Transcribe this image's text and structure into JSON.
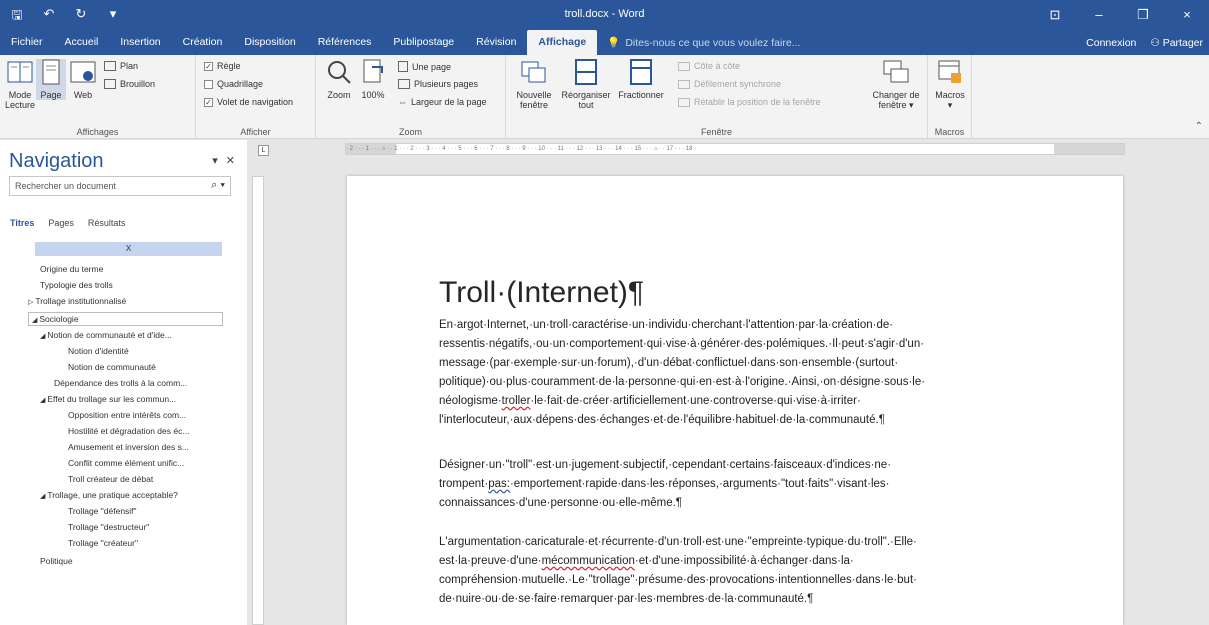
{
  "window": {
    "title": "troll.docx - Word",
    "qat": [
      "save-icon",
      "undo-icon",
      "redo-icon",
      "customize-icon"
    ],
    "controls": {
      "restore": "⊡",
      "minimize": "–",
      "maximize": "❐",
      "close": "×"
    }
  },
  "tabs": [
    "Fichier",
    "Accueil",
    "Insertion",
    "Création",
    "Disposition",
    "Références",
    "Publipostage",
    "Révision",
    "Affichage"
  ],
  "tell_me": "Dites-nous ce que vous voulez faire...",
  "tabs_right": {
    "signin": "Connexion",
    "share": "Partager"
  },
  "ribbon": {
    "affichages": {
      "label": "Affichages",
      "mode_lecture": [
        "Mode",
        "Lecture"
      ],
      "page": "Page",
      "web": "Web",
      "plan": "Plan",
      "brouillon": "Brouillon"
    },
    "afficher": {
      "label": "Afficher",
      "regle": "Règle",
      "quadrillage": "Quadrillage",
      "volet": "Volet de navigation"
    },
    "zoom": {
      "label": "Zoom",
      "zoom": "Zoom",
      "pct": "100%",
      "une_page": "Une page",
      "plusieurs": "Plusieurs pages",
      "largeur": "Largeur de la page"
    },
    "fenetre": {
      "label": "Fenêtre",
      "nouvelle": [
        "Nouvelle",
        "fenêtre"
      ],
      "reorganiser": [
        "Réorganiser",
        "tout"
      ],
      "fractionner": "Fractionner",
      "cote": "Côte à côte",
      "defilement": "Défilement synchrone",
      "retablir": "Rétablir la position de la fenêtre",
      "changer": [
        "Changer de",
        "fenêtre ▾"
      ]
    },
    "macros": {
      "label": "Macros",
      "macros": "Macros"
    }
  },
  "nav": {
    "title": "Navigation",
    "search_placeholder": "Rechercher un document",
    "tabs": [
      "Titres",
      "Pages",
      "Résultats"
    ],
    "header_item": "X",
    "items": [
      "Origine du terme",
      "Typologie des trolls",
      "Trollage institutionnalisé",
      "Sociologie",
      "Notion de communauté et d'ide...",
      "Notion d'identité",
      "Notion de communauté",
      "Dépendance des trolls à la comm...",
      "Effet du trollage sur les commun...",
      "Opposition entre intérêts com...",
      "Hostilité et dégradation des éc...",
      "Amusement et inversion des s...",
      "Conflit comme élément unific...",
      "Troll créateur de débat",
      "Trollage, une pratique acceptable?",
      "Trollage \"défensif\"",
      "Trollage \"destructeur\"",
      "Trollage \"créateur\"",
      "Politique"
    ]
  },
  "ruler_text": "· 2 · · · 1 · · · ⌂ · · 1 · · · 2 · · · 3 · · · 4 · · · 5 · · · 6 · · · 7 · · · 8 · · · 9 · · · 10 · · · 11 · · · 12 · · · 13 · · · 14 · · · 15 · · · ⌂ · · 17 · · · 18 ·",
  "doc": {
    "title": "Troll·(Internet)¶",
    "p1_a": "En·argot·Internet,·un·troll·caractérise·un·individu·cherchant·l'attention·par·la·création·de· ressentis·négatifs,·ou·un·comportement·qui·vise·à·générer·des·polémiques.·Il·peut·s'agir·d'un· message·(par·exemple·sur·un·forum),·d'un·débat·conflictuel·dans·son·ensemble·(surtout· politique)·ou·plus·couramment·de·la·personne·qui·en·est·à·l'origine.·Ainsi,·on·désigne·sous·le· néologisme·",
    "p1_troller": "troller",
    "p1_b": "·le·fait·de·créer·artificiellement·une·controverse·qui·vise·à·irriter· l'interlocuteur,·aux·dépens·des·échanges·et·de·l'équilibre·habituel·de·la·communauté.¶",
    "p2_a": "Désigner·un·\"troll\"·est·un·jugement·subjectif,·cependant·certains·faisceaux·d'indices·ne· trompent·",
    "p2_pas": "pas:",
    "p2_b": "·emportement·rapide·dans·les·réponses,·arguments·\"tout·faits\"·visant·les· connaissances·d'une·personne·ou·elle-même.¶",
    "p3_a": "L'argumentation·caricaturale·et·récurrente·d'un·troll·est·une·\"empreinte·typique·du·troll\".·Elle· est·la·preuve·d'une·",
    "p3_meco": "mécommunication",
    "p3_b": "·et·d'une·impossibilité·à·échanger·dans·la· compréhension·mutuelle.·Le·\"trollage\"·présume·des·provocations·intentionnelles·dans·le·but· de·nuire·ou·de·se·faire·remarquer·par·les·membres·de·la·communauté.¶"
  },
  "colors": {
    "brand": "#2b579a",
    "ribbon": "#f3f3f3",
    "canvas": "#e6e6e6"
  }
}
